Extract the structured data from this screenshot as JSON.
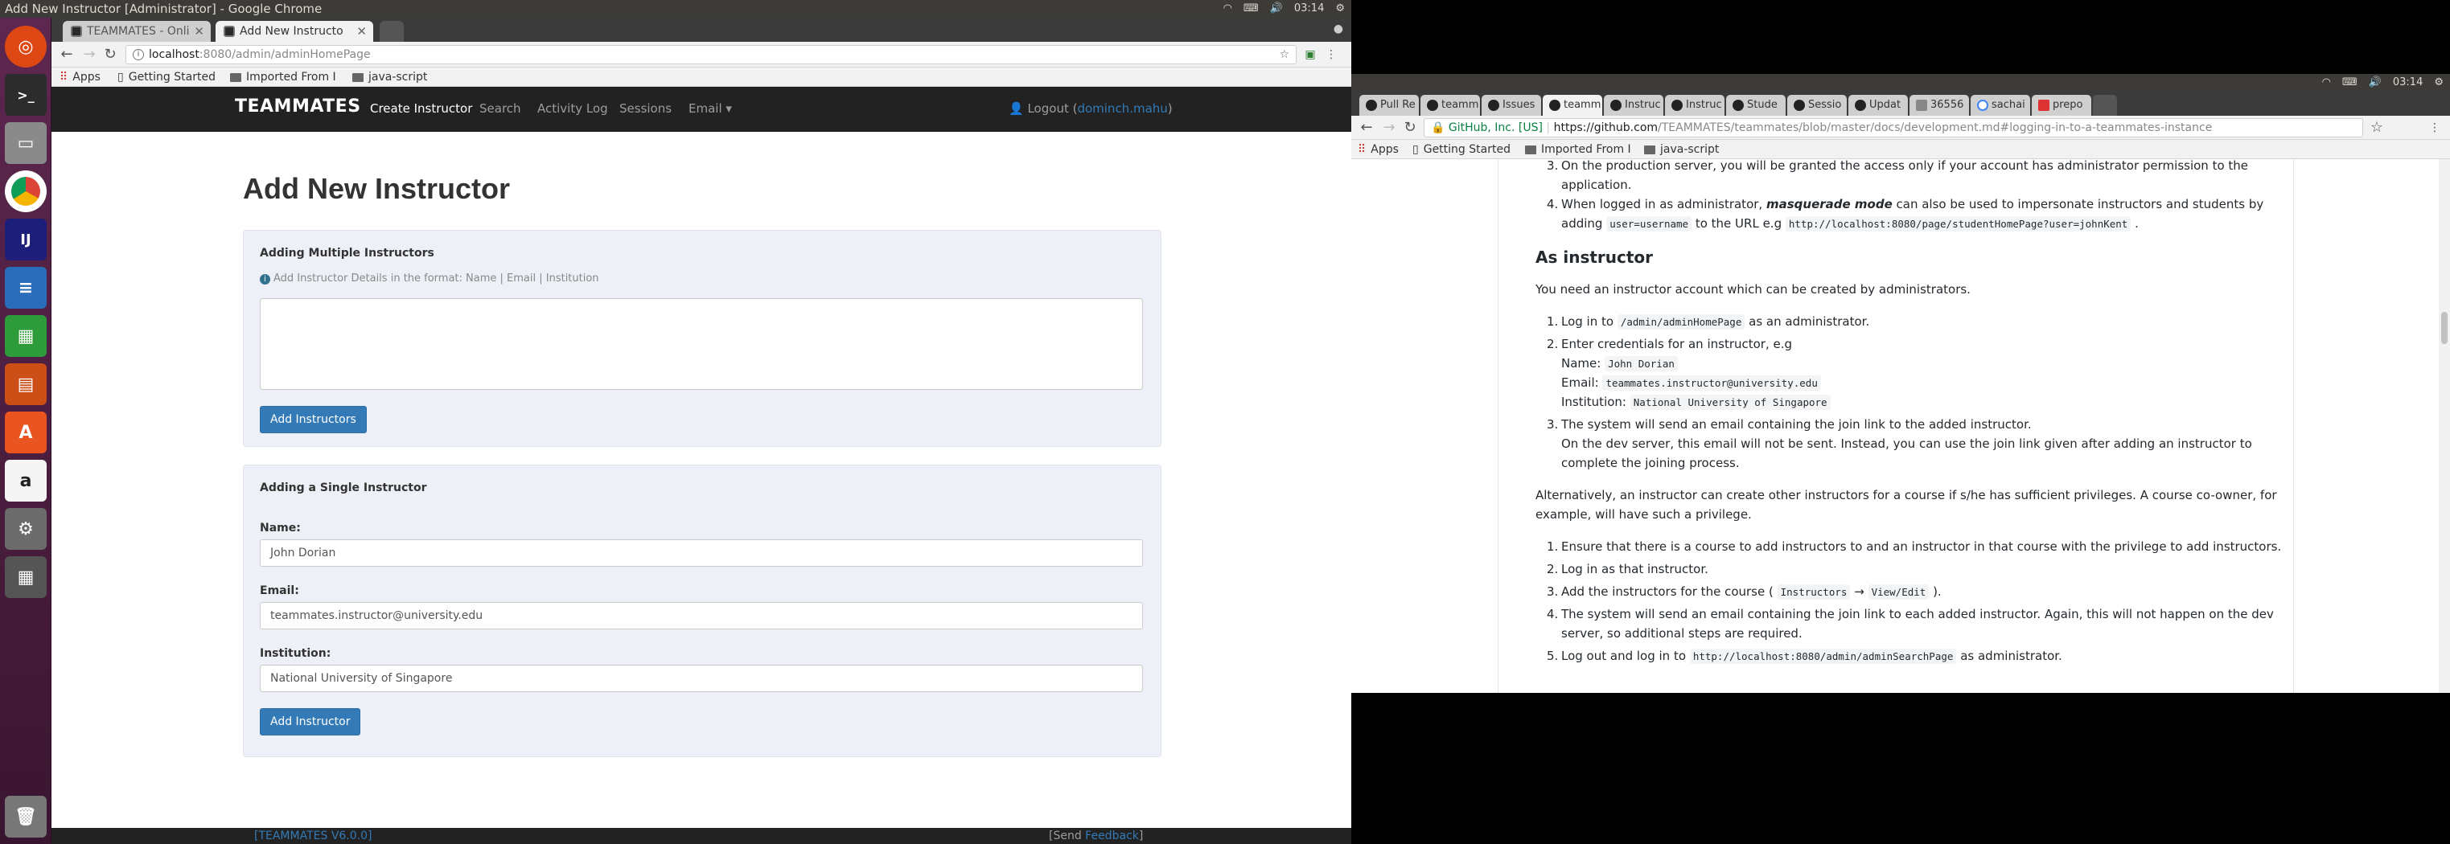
{
  "left": {
    "system_title": "Add New Instructor [Administrator] - Google Chrome",
    "clock": "03:14",
    "tabs": [
      "TEAMMATES - Onli",
      "Add New Instructo"
    ],
    "url": {
      "host": "localhost",
      "path": ":8080/admin/adminHomePage"
    },
    "bookmarks": [
      "Apps",
      "Getting Started",
      "Imported From I",
      "java-script"
    ],
    "nav": {
      "brand": "TEAMMATES",
      "links": [
        "Create Instructor",
        "Search",
        "Activity Log",
        "Sessions",
        "Email ▾"
      ],
      "logout_prefix": "Logout (",
      "user": "dominch.mahu",
      "logout_suffix": ")"
    },
    "page": {
      "title": "Add New Instructor",
      "multiple": {
        "heading": "Adding Multiple Instructors",
        "hint": "Add Instructor Details in the format: Name | Email | Institution",
        "button": "Add Instructors"
      },
      "single": {
        "heading": "Adding a Single Instructor",
        "name_label": "Name:",
        "name_value": "John Dorian",
        "email_label": "Email:",
        "email_value": "teammates.instructor@university.edu",
        "institution_label": "Institution:",
        "institution_value": "National University of Singapore",
        "button": "Add Instructor"
      }
    },
    "footer": {
      "version": "[TEAMMATES V6.0.0]",
      "send_prefix": "[Send ",
      "feedback": "Feedback",
      "send_suffix": "]"
    }
  },
  "right": {
    "clock": "03:14",
    "tabs": [
      "Pull Re",
      "teamm",
      "Issues",
      "teamm",
      "Instruc",
      "Instruc",
      "Stude",
      "Sessio",
      "Updat",
      "36556",
      "sachai",
      "prepo"
    ],
    "url": {
      "secure": "GitHub, Inc. [US]",
      "host": "https://github.com",
      "path": "/TEAMMATES/teammates/blob/master/docs/development.md#logging-in-to-a-teammates-instance"
    },
    "bookmarks": [
      "Apps",
      "Getting Started",
      "Imported From I",
      "java-script"
    ],
    "doc": {
      "item3": "On the production server, you will be granted the access only if your account has administrator permission to the",
      "item3b": "application.",
      "item4a": "When logged in as administrator,",
      "item4_em": "masquerade mode",
      "item4b": "can also be used to impersonate instructors and students by",
      "item4c": "adding",
      "item4_code1": "user=username",
      "item4d": "to the URL e.g",
      "item4_code2": "http://localhost:8080/page/studentHomePage?user=johnKent",
      "heading": "As instructor",
      "intro": "You need an instructor account which can be created by administrators.",
      "s1a": "Log in to",
      "s1_code": "/admin/adminHomePage",
      "s1b": "as an administrator.",
      "s2": "Enter credentials for an instructor, e.g",
      "name_label": "Name:",
      "name_code": "John Dorian",
      "email_label": "Email:",
      "email_code": "teammates.instructor@university.edu",
      "inst_label": "Institution:",
      "inst_code": "National University of Singapore",
      "s3": "The system will send an email containing the join link to the added instructor.",
      "s3b": "On the dev server, this email will not be sent. Instead, you can use the join link given after adding an instructor to",
      "s3c": "complete the joining process.",
      "alt1": "Alternatively, an instructor can create other instructors for a course if s/he has sufficient privileges. A course co-owner, for",
      "alt2": "example, will have such a privilege.",
      "a1": "Ensure that there is a course to add instructors to and an instructor in that course with the privilege to add instructors.",
      "a2": "Log in as that instructor.",
      "a3a": "Add the instructors for the course (",
      "a3_code1": "Instructors",
      "a3_arrow": "→",
      "a3_code2": "View/Edit",
      "a3b": ").",
      "a4": "The system will send an email containing the join link to each added instructor. Again, this will not happen on the dev",
      "a4b": "server, so additional steps are required.",
      "a5a": "Log out and log in to",
      "a5_code": "http://localhost:8080/admin/adminSearchPage",
      "a5b": "as administrator."
    }
  }
}
